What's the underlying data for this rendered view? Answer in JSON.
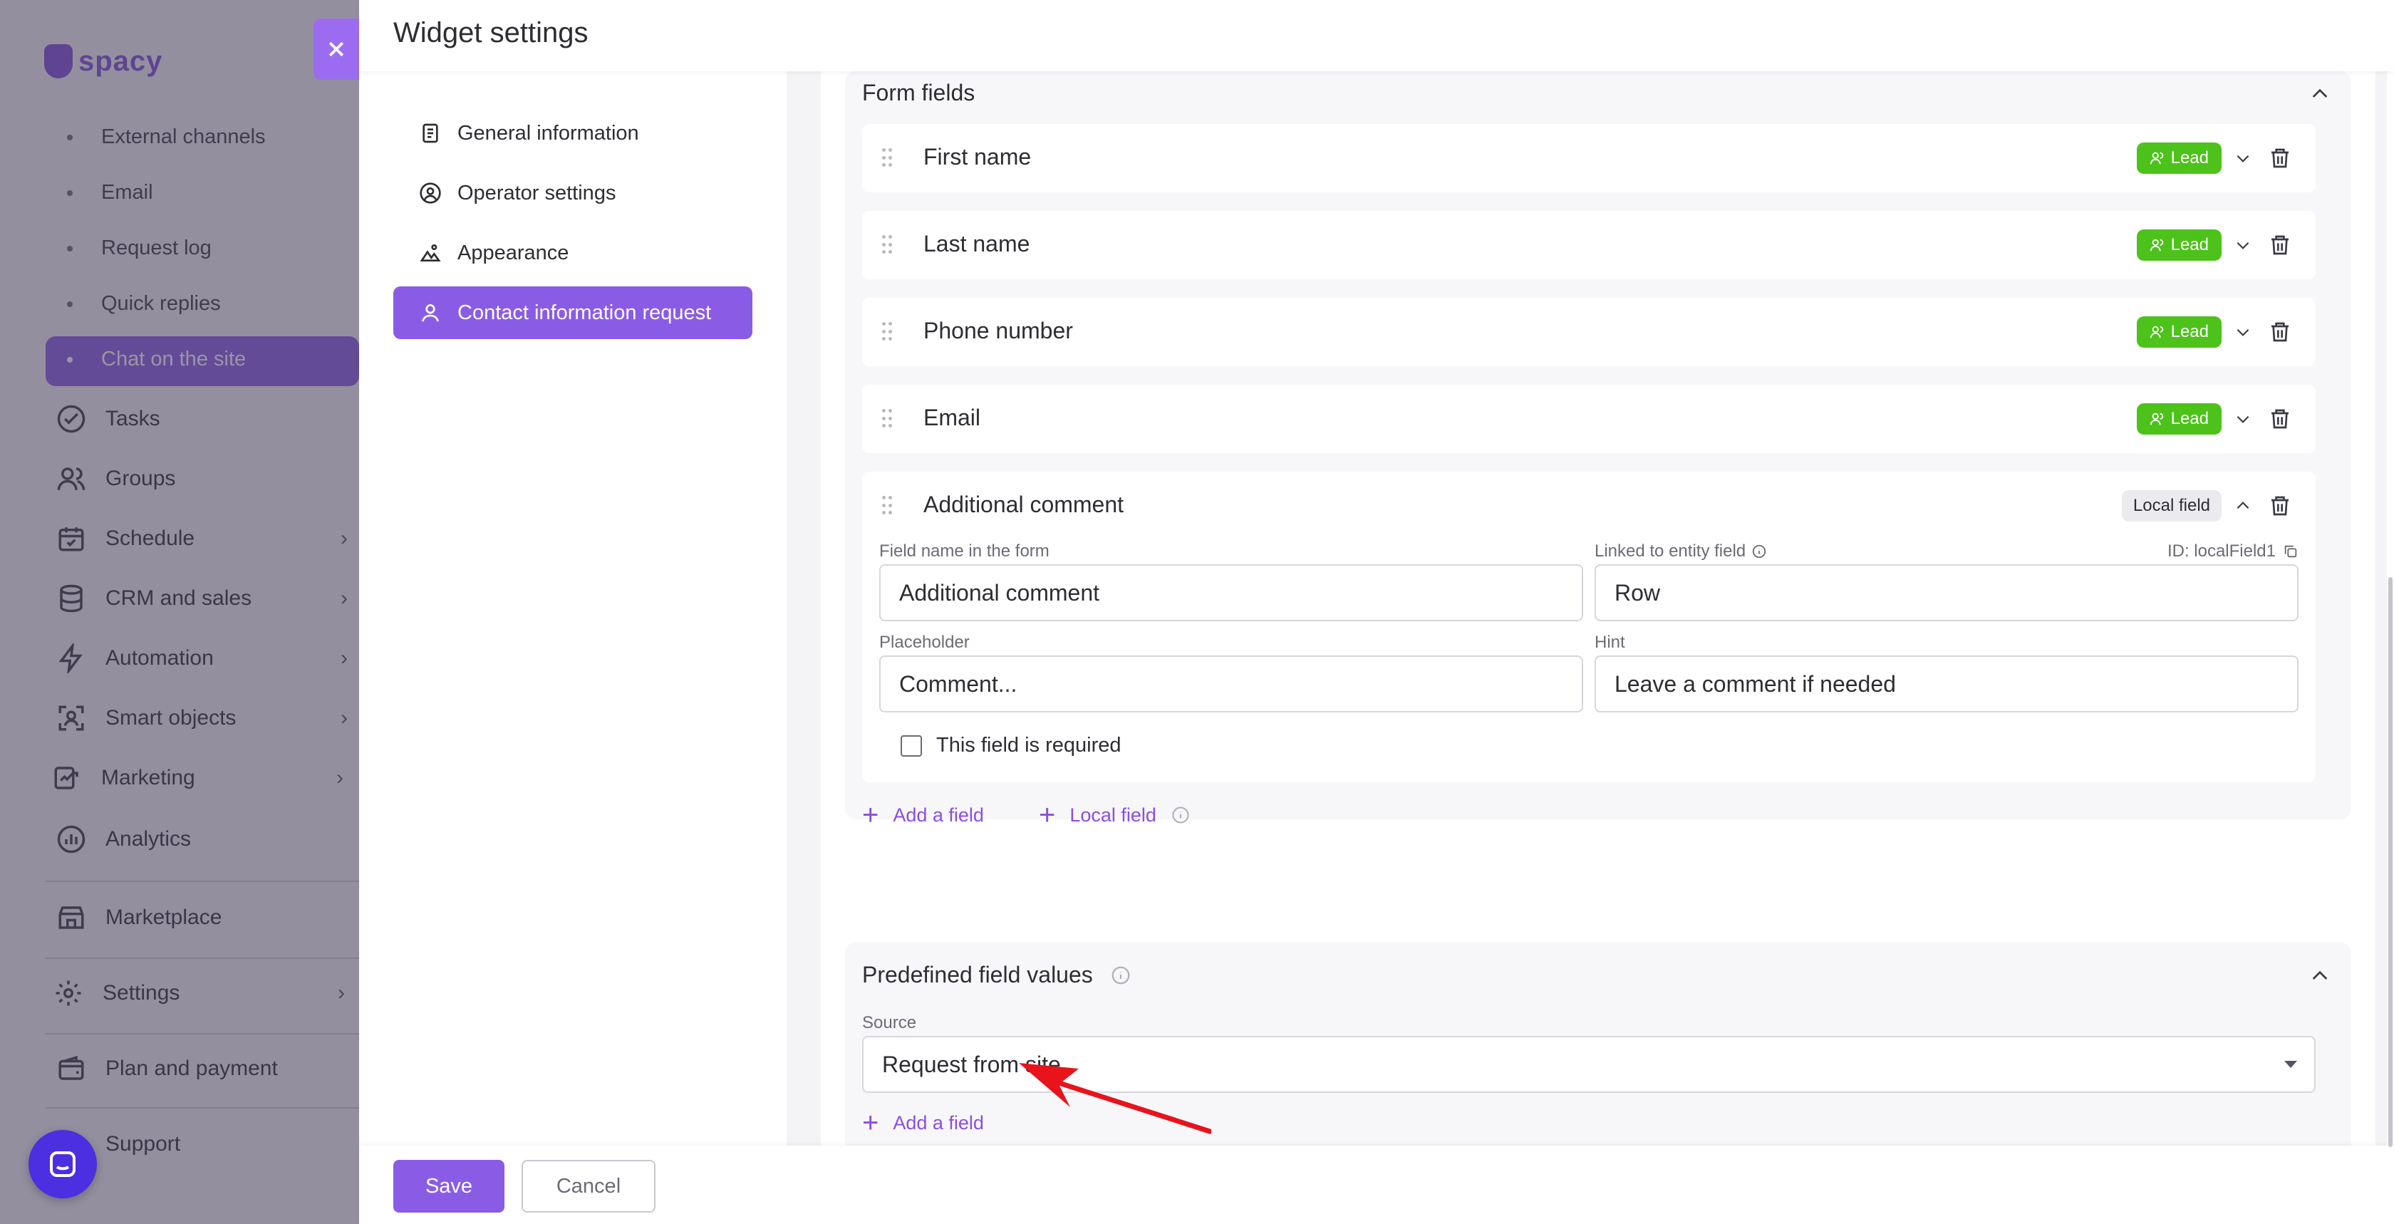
{
  "app": {
    "logo_text": "spacy",
    "sidebar": {
      "sub_items": [
        "External channels",
        "Email",
        "Request log",
        "Quick replies",
        "Chat on the site"
      ],
      "nav_items": [
        {
          "label": "Tasks",
          "icon": "check-circle-icon",
          "has_children": false
        },
        {
          "label": "Groups",
          "icon": "users-icon",
          "has_children": false
        },
        {
          "label": "Schedule",
          "icon": "calendar-icon",
          "has_children": true
        },
        {
          "label": "CRM and sales",
          "icon": "database-icon",
          "has_children": true
        },
        {
          "label": "Automation",
          "icon": "lightning-icon",
          "has_children": true
        },
        {
          "label": "Smart objects",
          "icon": "smart-objects-icon",
          "has_children": true
        },
        {
          "label": "Marketing",
          "icon": "marketing-icon",
          "has_children": true
        },
        {
          "label": "Analytics",
          "icon": "chart-icon",
          "has_children": false
        },
        {
          "label": "Marketplace",
          "icon": "store-icon",
          "has_children": false
        },
        {
          "label": "Settings",
          "icon": "gear-icon",
          "has_children": true
        },
        {
          "label": "Plan and payment",
          "icon": "wallet-icon",
          "has_children": false
        },
        {
          "label": "Support",
          "icon": "support-icon",
          "has_children": false
        }
      ],
      "active_sub_item": "Chat on the site"
    }
  },
  "panel": {
    "title": "Widget settings",
    "nav": [
      {
        "label": "General information",
        "icon": "document-icon"
      },
      {
        "label": "Operator settings",
        "icon": "user-circle-icon"
      },
      {
        "label": "Appearance",
        "icon": "image-icon"
      },
      {
        "label": "Contact information request",
        "icon": "user-icon"
      }
    ],
    "active_nav": "Contact information request"
  },
  "form_fields": {
    "title": "Form fields",
    "rows": [
      {
        "name": "First name",
        "badge": "Lead"
      },
      {
        "name": "Last name",
        "badge": "Lead"
      },
      {
        "name": "Phone number",
        "badge": "Lead"
      },
      {
        "name": "Email",
        "badge": "Lead"
      }
    ],
    "expanded": {
      "name": "Additional comment",
      "badge": "Local field",
      "field_name_label": "Field name in the form",
      "field_name_value": "Additional comment",
      "linked_label": "Linked to entity field",
      "linked_value": "Row",
      "id_text": "ID: localField1",
      "placeholder_label": "Placeholder",
      "placeholder_value": "Comment...",
      "hint_label": "Hint",
      "hint_value": "Leave a comment if needed",
      "required_label": "This field is required",
      "required_checked": false
    },
    "add_field": "Add a field",
    "local_field": "Local field"
  },
  "predefined": {
    "title": "Predefined field values",
    "source_label": "Source",
    "source_value": "Request from site",
    "add_field": "Add a field"
  },
  "footer": {
    "save": "Save",
    "cancel": "Cancel"
  },
  "colors": {
    "accent": "#8a5ce6",
    "lead_badge": "#4cc21a",
    "link": "#8a4fe0",
    "annotation_arrow": "#e8131b"
  }
}
